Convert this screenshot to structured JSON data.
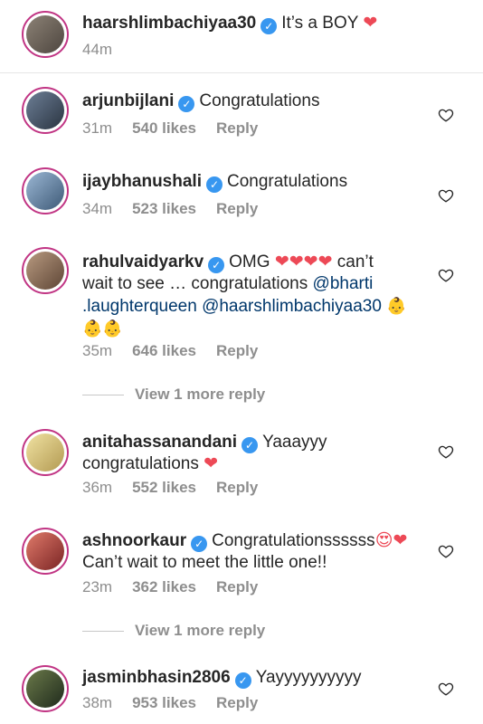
{
  "caption": {
    "username": "haarshlimbachiyaa30",
    "text": "It’s a BOY",
    "heart": "❤",
    "time": "44m",
    "avatar_color": "#6b6258"
  },
  "comments": [
    {
      "username": "arjunbijlani",
      "text": "Congratulations",
      "time": "31m",
      "likes": "540 likes",
      "reply": "Reply",
      "avatar_color": "#3b4a5f"
    },
    {
      "username": "ijaybhanushali",
      "text": "Congratulations",
      "time": "34m",
      "likes": "523 likes",
      "reply": "Reply",
      "avatar_color": "#5b7fa3"
    },
    {
      "username": "rahulvaidyarkv",
      "text_part1": "OMG",
      "hearts": "❤❤❤❤",
      "text_part2": "can’t wait to see … congratulations",
      "mention1": "@bharti .laughterqueen",
      "mention2": "@haarshlimbachiyaa30",
      "babies": "👶 👶👶",
      "time": "35m",
      "likes": "646 likes",
      "reply": "Reply",
      "view_more": "View 1 more reply",
      "avatar_color": "#8a6a52"
    },
    {
      "username": "anitahassanandani",
      "text": "Yaaayyy congratulations",
      "heart": "❤",
      "time": "36m",
      "likes": "552 likes",
      "reply": "Reply",
      "avatar_color": "#d9c47a"
    },
    {
      "username": "ashnoorkaur",
      "text": "Congratulationssssss",
      "emojis": "😍❤",
      "text2": "Can’t wait to meet the little one!!",
      "time": "23m",
      "likes": "362 likes",
      "reply": "Reply",
      "view_more": "View 1 more reply",
      "avatar_color": "#c44a4a"
    },
    {
      "username": "jasminbhasin2806",
      "text": "Yayyyyyyyyyy",
      "time": "38m",
      "likes": "953 likes",
      "reply": "Reply",
      "avatar_color": "#2f3b2c"
    }
  ],
  "colors": {
    "verified": "#3897f0",
    "heart": "#ed4956",
    "mention": "#00376b",
    "meta": "#8e8e8e"
  },
  "icons": {
    "verified": "verified-badge-icon",
    "like": "heart-outline-icon"
  }
}
